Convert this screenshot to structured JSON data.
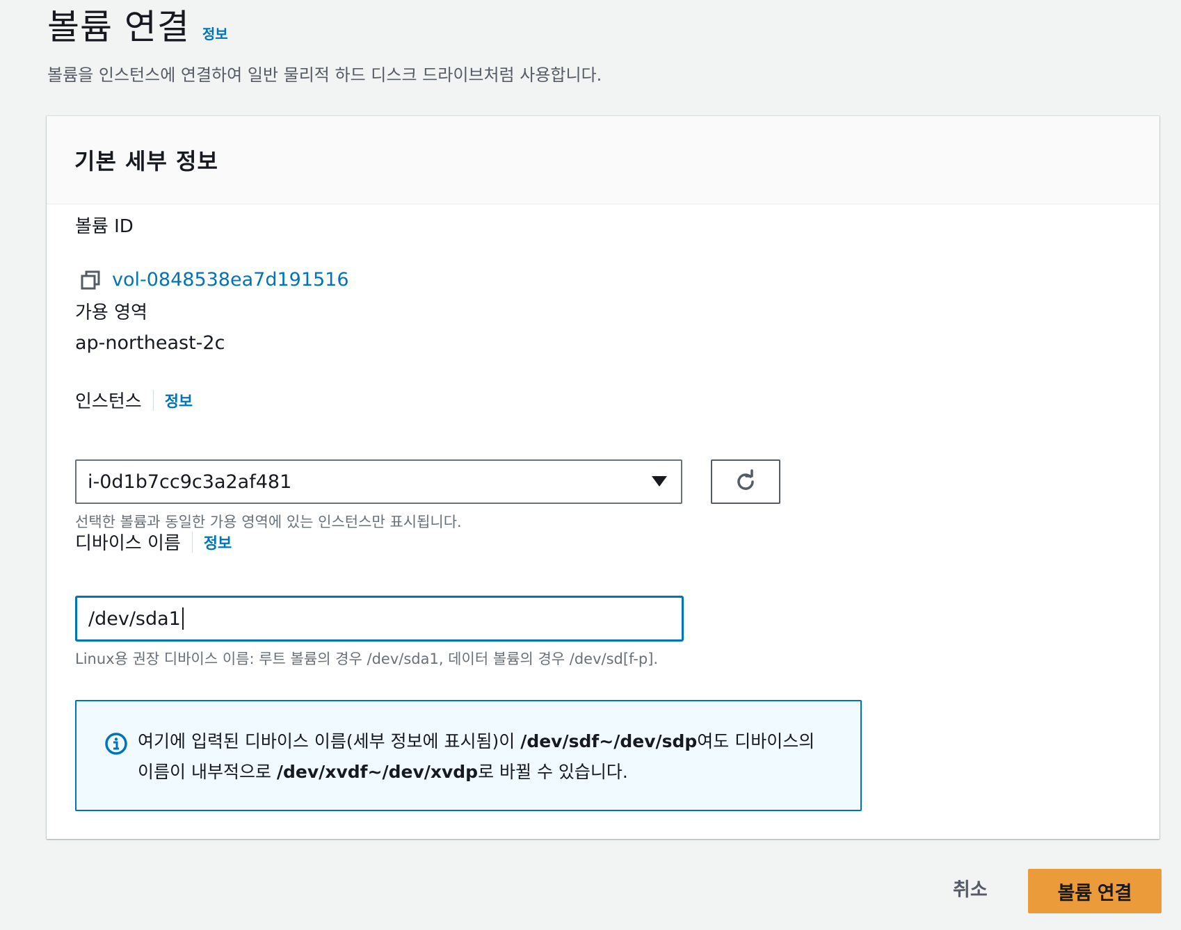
{
  "page": {
    "title": "볼륨 연결",
    "info_label": "정보",
    "description": "볼륨을 인스턴스에 연결하여 일반 물리적 하드 디스크 드라이브처럼 사용합니다."
  },
  "panel": {
    "title": "기본 세부 정보",
    "volume_id": {
      "label": "볼륨 ID",
      "value": "vol-0848538ea7d191516",
      "icon": "copy-icon"
    },
    "availability_zone": {
      "label": "가용 영역",
      "value": "ap-northeast-2c"
    },
    "instance": {
      "label": "인스턴스",
      "info_label": "정보",
      "selected_value": "i-0d1b7cc9c3a2af481",
      "hint": "선택한 볼륨과 동일한 가용 영역에 있는 인스턴스만 표시됩니다.",
      "refresh_icon": "refresh-icon"
    },
    "device_name": {
      "label": "디바이스 이름",
      "info_label": "정보",
      "value": "/dev/sda1",
      "hint": "Linux용 권장 디바이스 이름: 루트 볼륨의 경우 /dev/sda1, 데이터 볼륨의 경우 /dev/sd[f-p]."
    },
    "alert": {
      "icon": "info-icon",
      "text_1": "여기에 입력된 디바이스 이름(세부 정보에 표시됨)이 ",
      "bold_1": "/dev/sdf~/dev/sdp",
      "text_2": "여도 디바이스의 이름이 내부적으로 ",
      "bold_2": "/dev/xvdf~/dev/xvdp",
      "text_3": "로 바뀔 수 있습니다."
    }
  },
  "footer": {
    "cancel_label": "취소",
    "submit_label": "볼륨 연결"
  },
  "colors": {
    "accent": "#0073bb",
    "primary_button": "#ec9b3b",
    "background": "#f2f3f3"
  }
}
